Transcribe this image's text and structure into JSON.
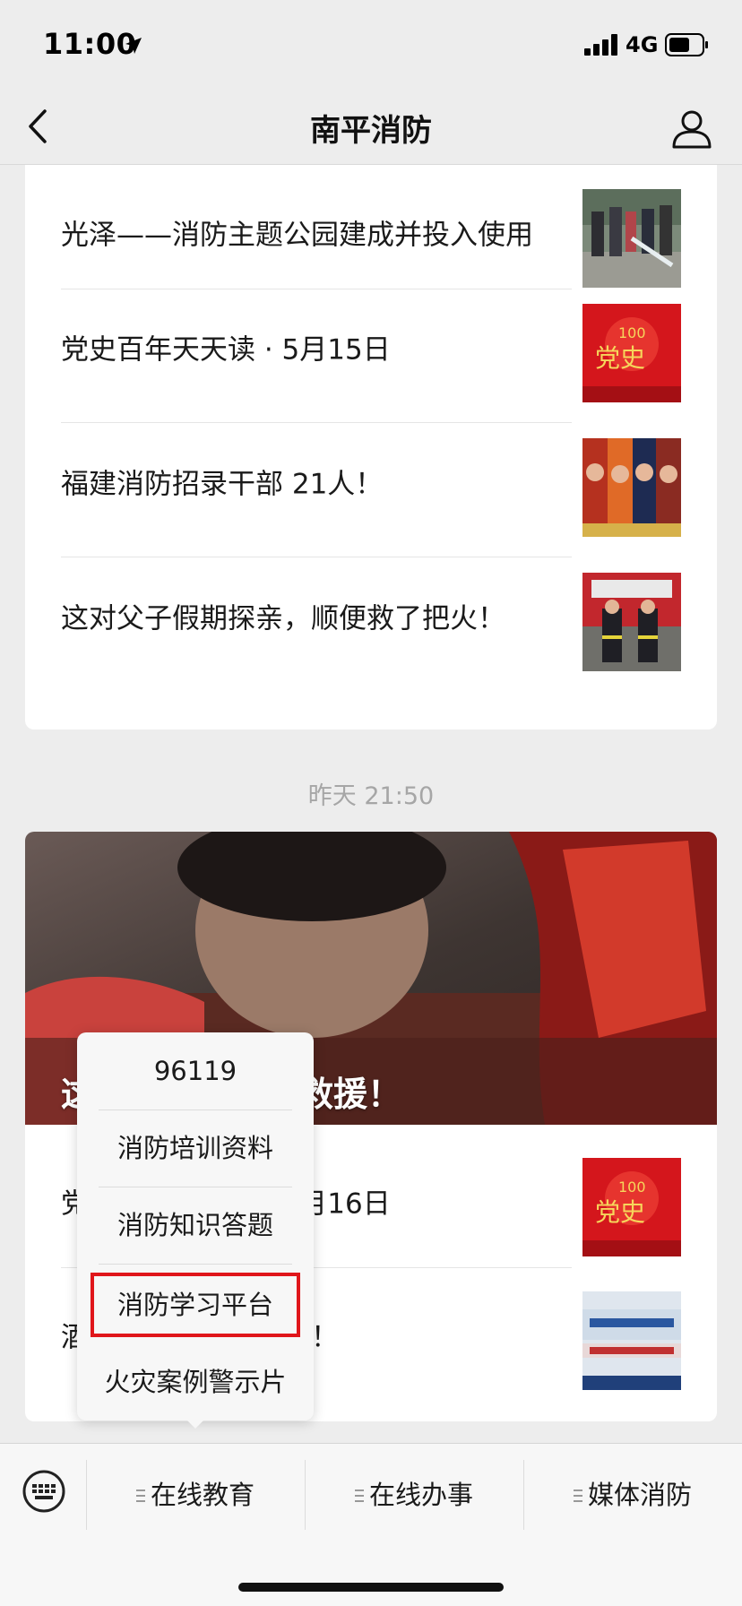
{
  "status": {
    "time": "11:00",
    "network": "4G"
  },
  "nav": {
    "title": "南平消防"
  },
  "feed": {
    "group1": {
      "articles": [
        {
          "title": "光泽——消防主题公园建成并投入使用",
          "thumb": "fire-extinguisher-demo-photo"
        },
        {
          "title": "党史百年天天读 · 5月15日",
          "thumb": "party-history-100-red-banner"
        },
        {
          "title": "福建消防招录干部 21人！",
          "thumb": "firefighters-portrait-photo"
        },
        {
          "title": "这对父子假期探亲，顺便救了把火！",
          "thumb": "firefighters-with-truck-photo"
        }
      ]
    },
    "timestamp": "昨天 21:50",
    "group2": {
      "hero_title": "这一幕…因生死救援！",
      "articles": [
        {
          "title": "党史百年天天读 · 5月16日",
          "thumb": "party-history-100-red-banner"
        },
        {
          "title": "酒精消毒不当引起火！",
          "thumb": "alcohol-disinfection-notice"
        }
      ]
    }
  },
  "popup_menu": {
    "items": [
      "96119",
      "消防培训资料",
      "消防知识答题",
      "消防学习平台",
      "火灾案例警示片"
    ],
    "highlighted_index": 3,
    "highlight_color": "#e0161b"
  },
  "bottom_menu": {
    "items": [
      "在线教育",
      "在线办事",
      "媒体消防"
    ]
  }
}
